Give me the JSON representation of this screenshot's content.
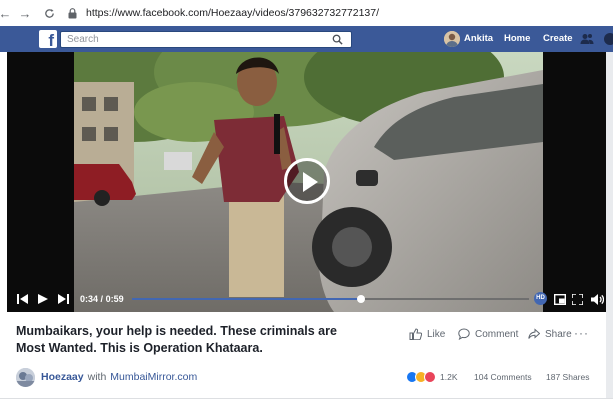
{
  "browser": {
    "url": "https://www.facebook.com/Hoezaay/videos/379632732772137/",
    "back_icon": "back-arrow-icon",
    "forward_icon": "forward-arrow-icon",
    "reload_icon": "reload-icon",
    "lock_icon": "lock-icon"
  },
  "topbar": {
    "brand_color": "#3b5998",
    "logo": "f",
    "search_placeholder": "Search",
    "user_name": "Ankita",
    "home_label": "Home",
    "create_label": "Create"
  },
  "video": {
    "current_time": "0:34",
    "separator": "/",
    "duration": "0:59",
    "progress_fraction": 0.576,
    "accent": "#4267b2",
    "hd_badge": "HD"
  },
  "post": {
    "title": "Mumbaikars, your help is needed. These criminals are Most Wanted. This is Operation Khataara.",
    "like_label": "Like",
    "comment_label": "Comment",
    "share_label": "Share",
    "more_label": "···",
    "author": "Hoezaay",
    "with_label": "with",
    "tagged_page": "MumbaiMirror.com",
    "reaction_count": "1.2K",
    "comments_count": "104 Comments",
    "shares_count": "187 Shares",
    "reaction_colors": [
      "#1877f2",
      "#f7b125",
      "#e9445a"
    ]
  }
}
